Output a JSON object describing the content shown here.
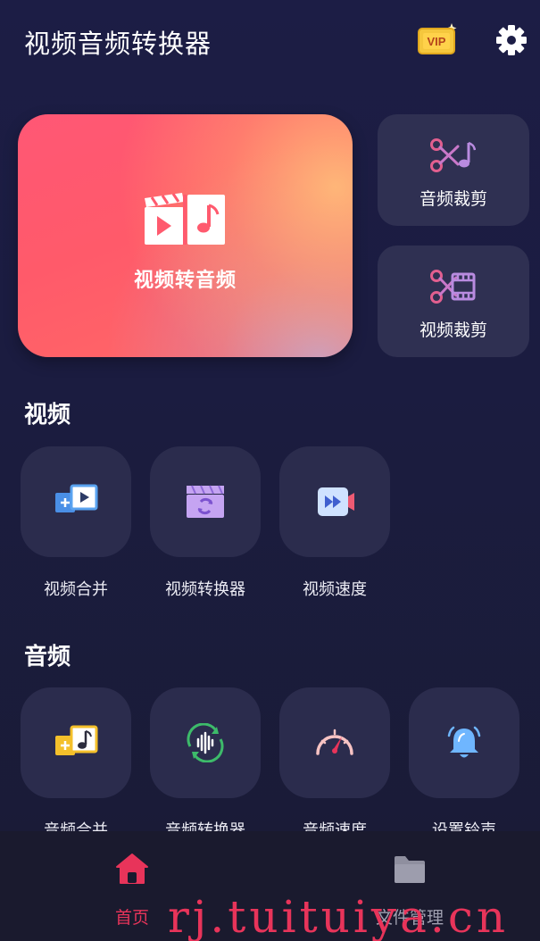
{
  "header": {
    "title": "视频音频转换器",
    "vip_icon": "vip-badge-icon",
    "vip_label": "VIP",
    "settings_icon": "gear-icon"
  },
  "hero": {
    "label": "视频转音频",
    "icon": "video-to-audio-icon"
  },
  "side_cards": [
    {
      "label": "音频裁剪",
      "icon": "audio-cut-icon"
    },
    {
      "label": "视频裁剪",
      "icon": "video-cut-icon"
    }
  ],
  "sections": {
    "video": {
      "title": "视频",
      "tools": [
        {
          "label": "视频合并",
          "icon": "video-merge-icon"
        },
        {
          "label": "视频转换器",
          "icon": "video-convert-icon"
        },
        {
          "label": "视频速度",
          "icon": "video-speed-icon"
        }
      ]
    },
    "audio": {
      "title": "音频",
      "tools": [
        {
          "label": "音频合并",
          "icon": "audio-merge-icon"
        },
        {
          "label": "音频转换器",
          "icon": "audio-convert-icon"
        },
        {
          "label": "音频速度",
          "icon": "audio-speed-icon"
        },
        {
          "label": "设置铃声",
          "icon": "bell-icon"
        }
      ]
    }
  },
  "bottom_nav": [
    {
      "label": "首页",
      "icon": "home-icon",
      "active": true
    },
    {
      "label": "文件管理",
      "icon": "folder-icon",
      "active": false
    }
  ],
  "watermark": "rj.tuituiya.cn",
  "colors": {
    "background": "#1c1d45",
    "card": "#2f3052",
    "tool_box": "#2b2c4d",
    "accent": "#e8345a",
    "hero_start": "#ff5775",
    "hero_end": "#ffb478",
    "vip_gold": "#f5c73d"
  }
}
